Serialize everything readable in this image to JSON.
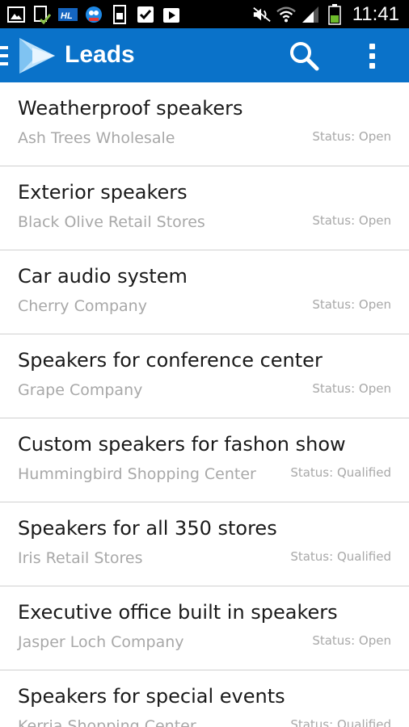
{
  "status_bar": {
    "left_icons": [
      "gallery-icon",
      "download-done-icon",
      "hl-app-icon",
      "game-app-icon",
      "sd-card-icon",
      "task-check-icon",
      "play-store-icon"
    ],
    "right_icons": [
      "mute-icon",
      "wifi-icon",
      "signal-icon",
      "battery-icon"
    ],
    "time": "11:41"
  },
  "action_bar": {
    "title": "Leads",
    "background": "#0a72c9",
    "icons": [
      "menu-icon",
      "app-logo-icon",
      "search-icon",
      "overflow-menu-icon"
    ]
  },
  "leads": [
    {
      "title": "Weatherproof speakers",
      "company": "Ash Trees Wholesale",
      "status": "Status: Open"
    },
    {
      "title": "Exterior speakers",
      "company": "Black Olive Retail Stores",
      "status": "Status: Open"
    },
    {
      "title": "Car audio system",
      "company": "Cherry Company",
      "status": "Status: Open"
    },
    {
      "title": "Speakers for conference center",
      "company": "Grape Company",
      "status": "Status: Open"
    },
    {
      "title": "Custom speakers for fashon show",
      "company": "Hummingbird Shopping Center",
      "status": "Status: Qualified"
    },
    {
      "title": "Speakers for all 350 stores",
      "company": "Iris Retail Stores",
      "status": "Status: Qualified"
    },
    {
      "title": "Executive office built in speakers",
      "company": "Jasper Loch Company",
      "status": "Status: Open"
    },
    {
      "title": "Speakers for special events",
      "company": "Kerria Shopping Center",
      "status": "Status: Qualified"
    }
  ]
}
